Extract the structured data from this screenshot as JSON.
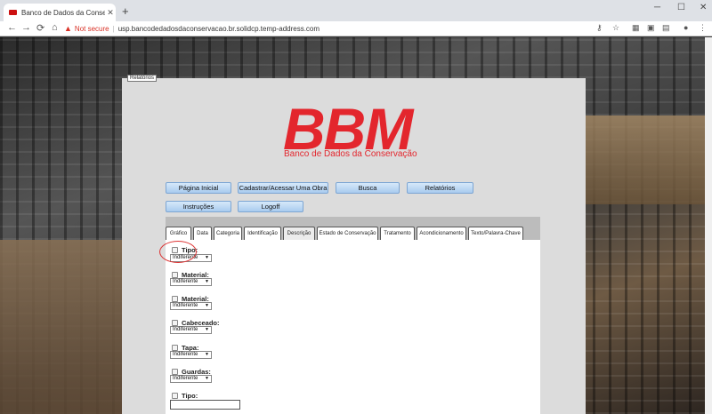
{
  "browser": {
    "tab_title": "Banco de Dados da Conservação",
    "tab_close": "✕",
    "new_tab": "+",
    "window_controls": [
      "─",
      "☐",
      "✕"
    ],
    "nav": [
      "←",
      "→",
      "⟳",
      "⌂"
    ],
    "not_secure": "Not secure",
    "separator": "|",
    "url": "usp.bancodedadosdaconservacao.br.solidcp.temp-address.com"
  },
  "tooltip": "Relatórios",
  "logo": {
    "text": "BBM",
    "subtitle": "Banco de Dados da Conservação",
    "color": "#e3262d"
  },
  "nav_buttons": [
    "Página Inicial",
    "Cadastrar/Acessar Uma Obra",
    "Busca",
    "Relatórios",
    "Instruções",
    "Logoff"
  ],
  "tabs": [
    "Gráfico",
    "Data",
    "Categoria",
    "Identificação",
    "Descrição",
    "Estado de Conservação",
    "Tratamento",
    "Acondicionamento",
    "Texto/Palavra-Chave"
  ],
  "active_tab": "Descrição",
  "fields": [
    {
      "label": "Tipo:",
      "value": "Indiferente"
    },
    {
      "label": "Material:",
      "value": "Indiferente"
    },
    {
      "label": "Material:",
      "value": "Indiferente"
    },
    {
      "label": "Cabeceado:",
      "value": "Indiferente"
    },
    {
      "label": "Tapa:",
      "value": "Indiferente"
    },
    {
      "label": "Guardas:",
      "value": "Indiferente"
    },
    {
      "label": "Tipo:",
      "value": ""
    }
  ]
}
